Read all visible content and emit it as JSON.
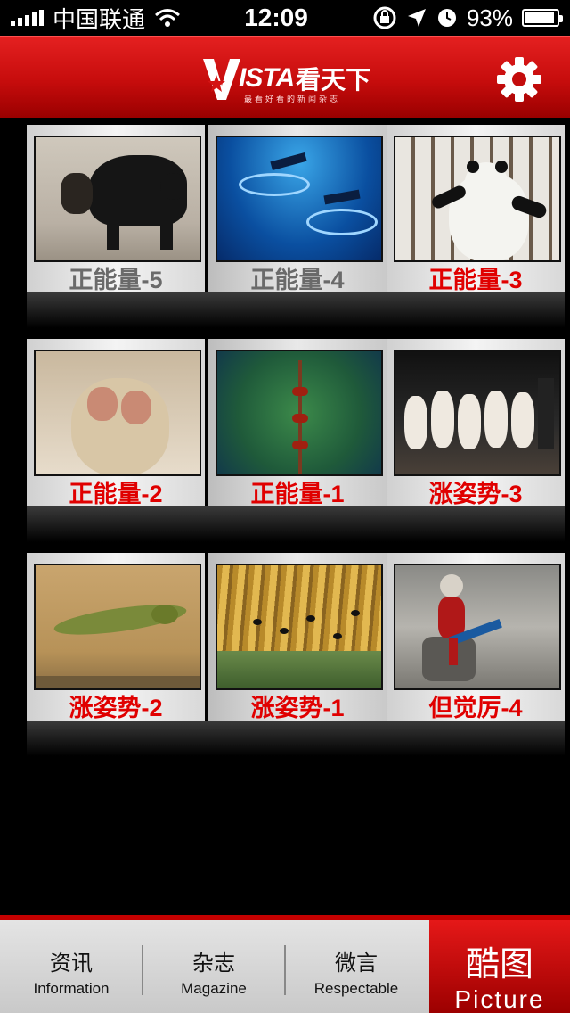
{
  "status": {
    "carrier": "中国联通",
    "time": "12:09",
    "battery": "93%",
    "battery_level": 0.93
  },
  "header": {
    "logo_text": "ISTA",
    "logo_cn": "看天下",
    "logo_sub": "最看好看的新闻杂志",
    "colors": {
      "primary": "#d41414",
      "accent": "#e00000"
    }
  },
  "gallery": {
    "items": [
      {
        "label": "正能量-5",
        "photo": "bear-carrying-cub"
      },
      {
        "label": "正能量-4",
        "photo": "divers-underwater"
      },
      {
        "label": "正能量-3",
        "photo": "panda-on-bars"
      },
      {
        "label": "正能量-2",
        "photo": "snow-monkeys-hugging"
      },
      {
        "label": "正能量-1",
        "photo": "ants-on-stem"
      },
      {
        "label": "涨姿势-3",
        "photo": "poodles-dancing"
      },
      {
        "label": "涨姿势-2",
        "photo": "leaping-frog"
      },
      {
        "label": "涨姿势-1",
        "photo": "tadpoles-underwater-forest"
      },
      {
        "label": "但觉厉-4",
        "photo": "monkey-with-guitar"
      }
    ]
  },
  "tabs": [
    {
      "cn": "资讯",
      "en": "Information"
    },
    {
      "cn": "杂志",
      "en": "Magazine"
    },
    {
      "cn": "微言",
      "en": "Respectable"
    },
    {
      "cn": "酷图",
      "en": "Picture"
    }
  ]
}
